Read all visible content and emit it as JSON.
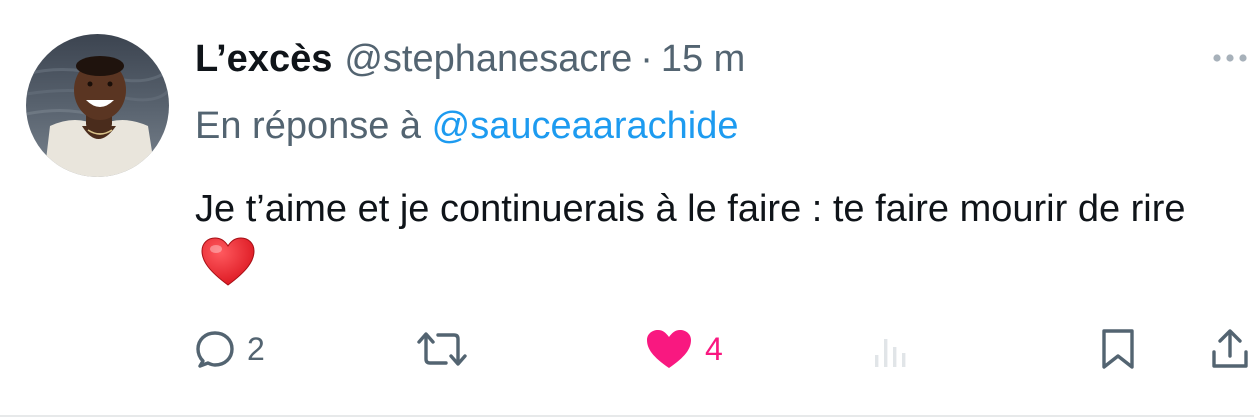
{
  "tweet": {
    "display_name": "L’excès",
    "handle": "@stephanesacre",
    "separator": "·",
    "time": "15 m",
    "reply_prefix": "En réponse à",
    "reply_mention": "@sauceaarachide",
    "text": "Je t’aime et je continuerais à le faire : te faire mourir de rire",
    "emoji": "red-heart-emoji"
  },
  "actions": {
    "reply": {
      "icon": "reply-icon",
      "count": "2"
    },
    "retweet": {
      "icon": "retweet-icon",
      "count": ""
    },
    "like": {
      "icon": "heart-icon",
      "count": "4",
      "active_color": "#f91880"
    },
    "views": {
      "icon": "analytics-icon",
      "count": ""
    },
    "bookmark": {
      "icon": "bookmark-icon"
    },
    "share": {
      "icon": "share-icon"
    }
  },
  "colors": {
    "primary_text": "#0f1419",
    "secondary_text": "#536471",
    "link": "#1d9bf0",
    "like": "#f91880"
  }
}
